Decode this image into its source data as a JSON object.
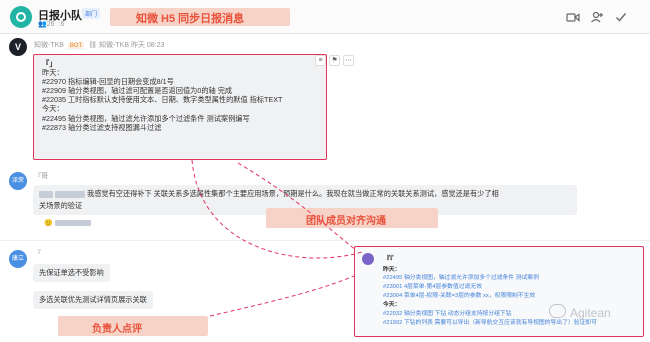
{
  "header": {
    "group_name": "日报小队",
    "dept_badge": "部门",
    "member_count": "26",
    "online_count": "6",
    "icons": [
      "video-icon",
      "add-member-icon",
      "check-icon"
    ]
  },
  "annotations": {
    "top": "知微 H5 同步日报消息",
    "middle": "团队成员对齐沟通",
    "bottom": "负责人点评"
  },
  "bot_message": {
    "avatar_letter": "V",
    "sender": "知微-TKB",
    "tag": "BOT",
    "sender_repeat": "知微-TKB",
    "time": "昨天 08:23",
    "author": "『」",
    "lines": [
      "昨天：",
      "#22970 指标编辑-回显的日期会变成8/1号",
      "#22909 轴分类视图，轴过滤可配置是否返回值为0的轴 完成",
      "#22035 工时指标默认支持使用文本、日期、数字类型属性的默值 指标TEXT",
      "今天：",
      "#22495 轴分类视图，轴过滤允许添加多个过滤条件 测试案例编写",
      "#22873 轴分类过滤支持视图漏斗过滤"
    ],
    "actions": [
      "≡",
      "⚑",
      "⋯"
    ]
  },
  "reply1": {
    "avatar_text": "泽荣",
    "sender": "『哥",
    "text_line1": "我感觉有空还得补下  关联关系多选属性集那个主要应用场景，预期是什么。我现在就当做正常的关联关系测试，感觉还是有少了相",
    "text_line2": "关场景的验证"
  },
  "reply2": {
    "avatar_text": "康立",
    "sender": "『",
    "text1": "先保证单选不受影响",
    "text2": "多选关联优先测试详情页展示关联"
  },
  "quote": {
    "author": "『『",
    "lines": [
      "昨天：",
      "#22495 轴分类视图，轴过滤允许添加多个过滤条件 测试案例",
      "#23001 4层菜单-第4层参数值过滤无效",
      "#23004 菜单4层-权限-关联=3层的参数 xx，权限限制不生效",
      "今天：",
      "#22932 轴分类视图 下钻 动态分组支持按分组下钻",
      "#21992 下钻的列表 需要可以导出（新导航交互应该就有导视图的导出了）验证即可"
    ]
  },
  "watermark": "Agitean",
  "colors": {
    "accent_red": "#e2335c",
    "highlight_bg": "#f7d3c7",
    "highlight_text": "#e9513a",
    "link_blue": "#3f7fd8",
    "logo_teal": "#22b4a4"
  }
}
